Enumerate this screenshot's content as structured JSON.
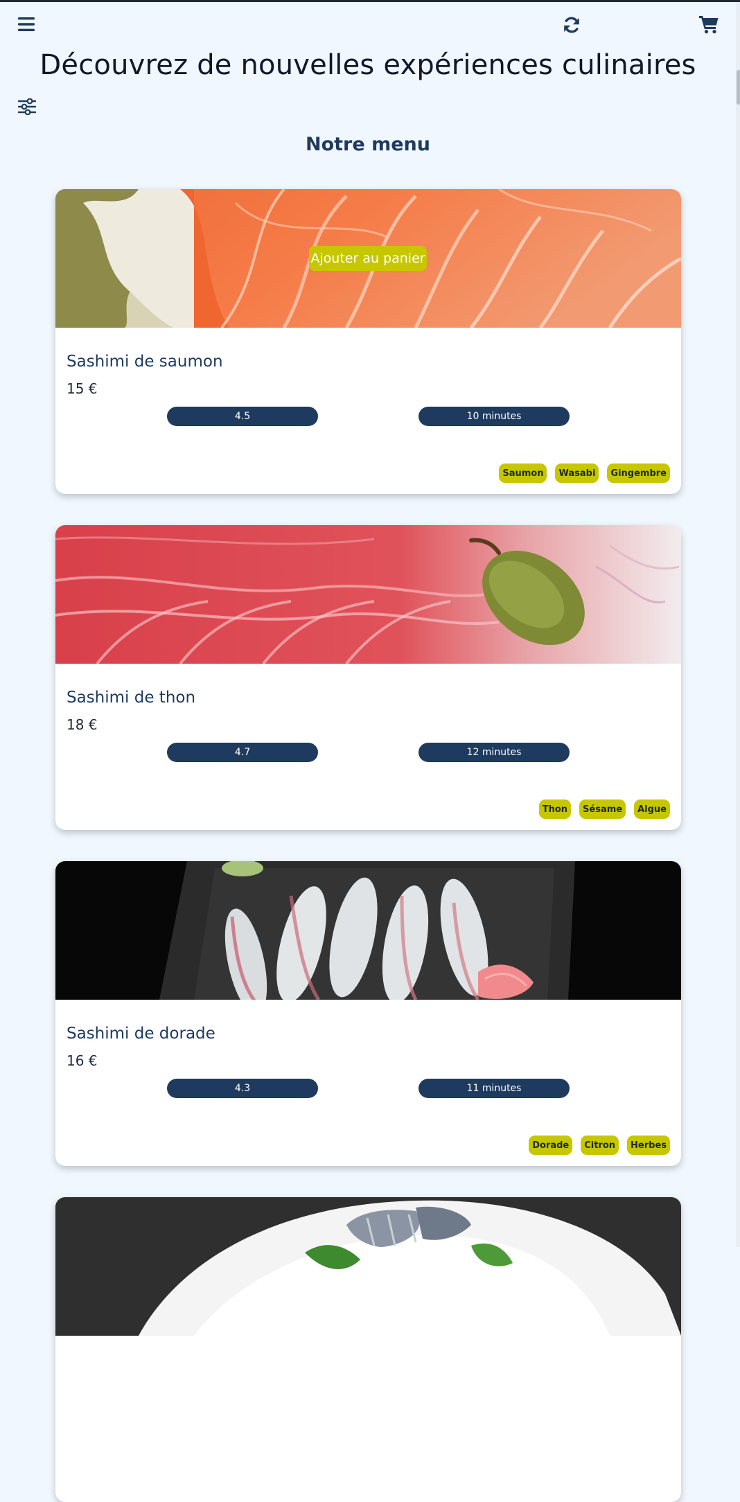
{
  "header": {
    "menu_icon": "hamburger-icon",
    "refresh_icon": "refresh-icon",
    "cart_icon": "shopping-cart-icon",
    "filter_icon": "sliders-icon",
    "title": "Découvrez de nouvelles expériences culinaires"
  },
  "section": {
    "title": "Notre menu"
  },
  "colors": {
    "background": "#f0f7fe",
    "primary": "#1e3a5f",
    "accent": "#c6c700"
  },
  "dishes": [
    {
      "name": "Sashimi de saumon",
      "price": "15 €",
      "rating": "4.5",
      "time": "10 minutes",
      "tags": [
        "Saumon",
        "Wasabi",
        "Gingembre"
      ],
      "add_label": "Ajouter au panier"
    },
    {
      "name": "Sashimi de thon",
      "price": "18 €",
      "rating": "4.7",
      "time": "12 minutes",
      "tags": [
        "Thon",
        "Sésame",
        "Algue"
      ]
    },
    {
      "name": "Sashimi de dorade",
      "price": "16 €",
      "rating": "4.3",
      "time": "11 minutes",
      "tags": [
        "Dorade",
        "Citron",
        "Herbes"
      ]
    }
  ]
}
